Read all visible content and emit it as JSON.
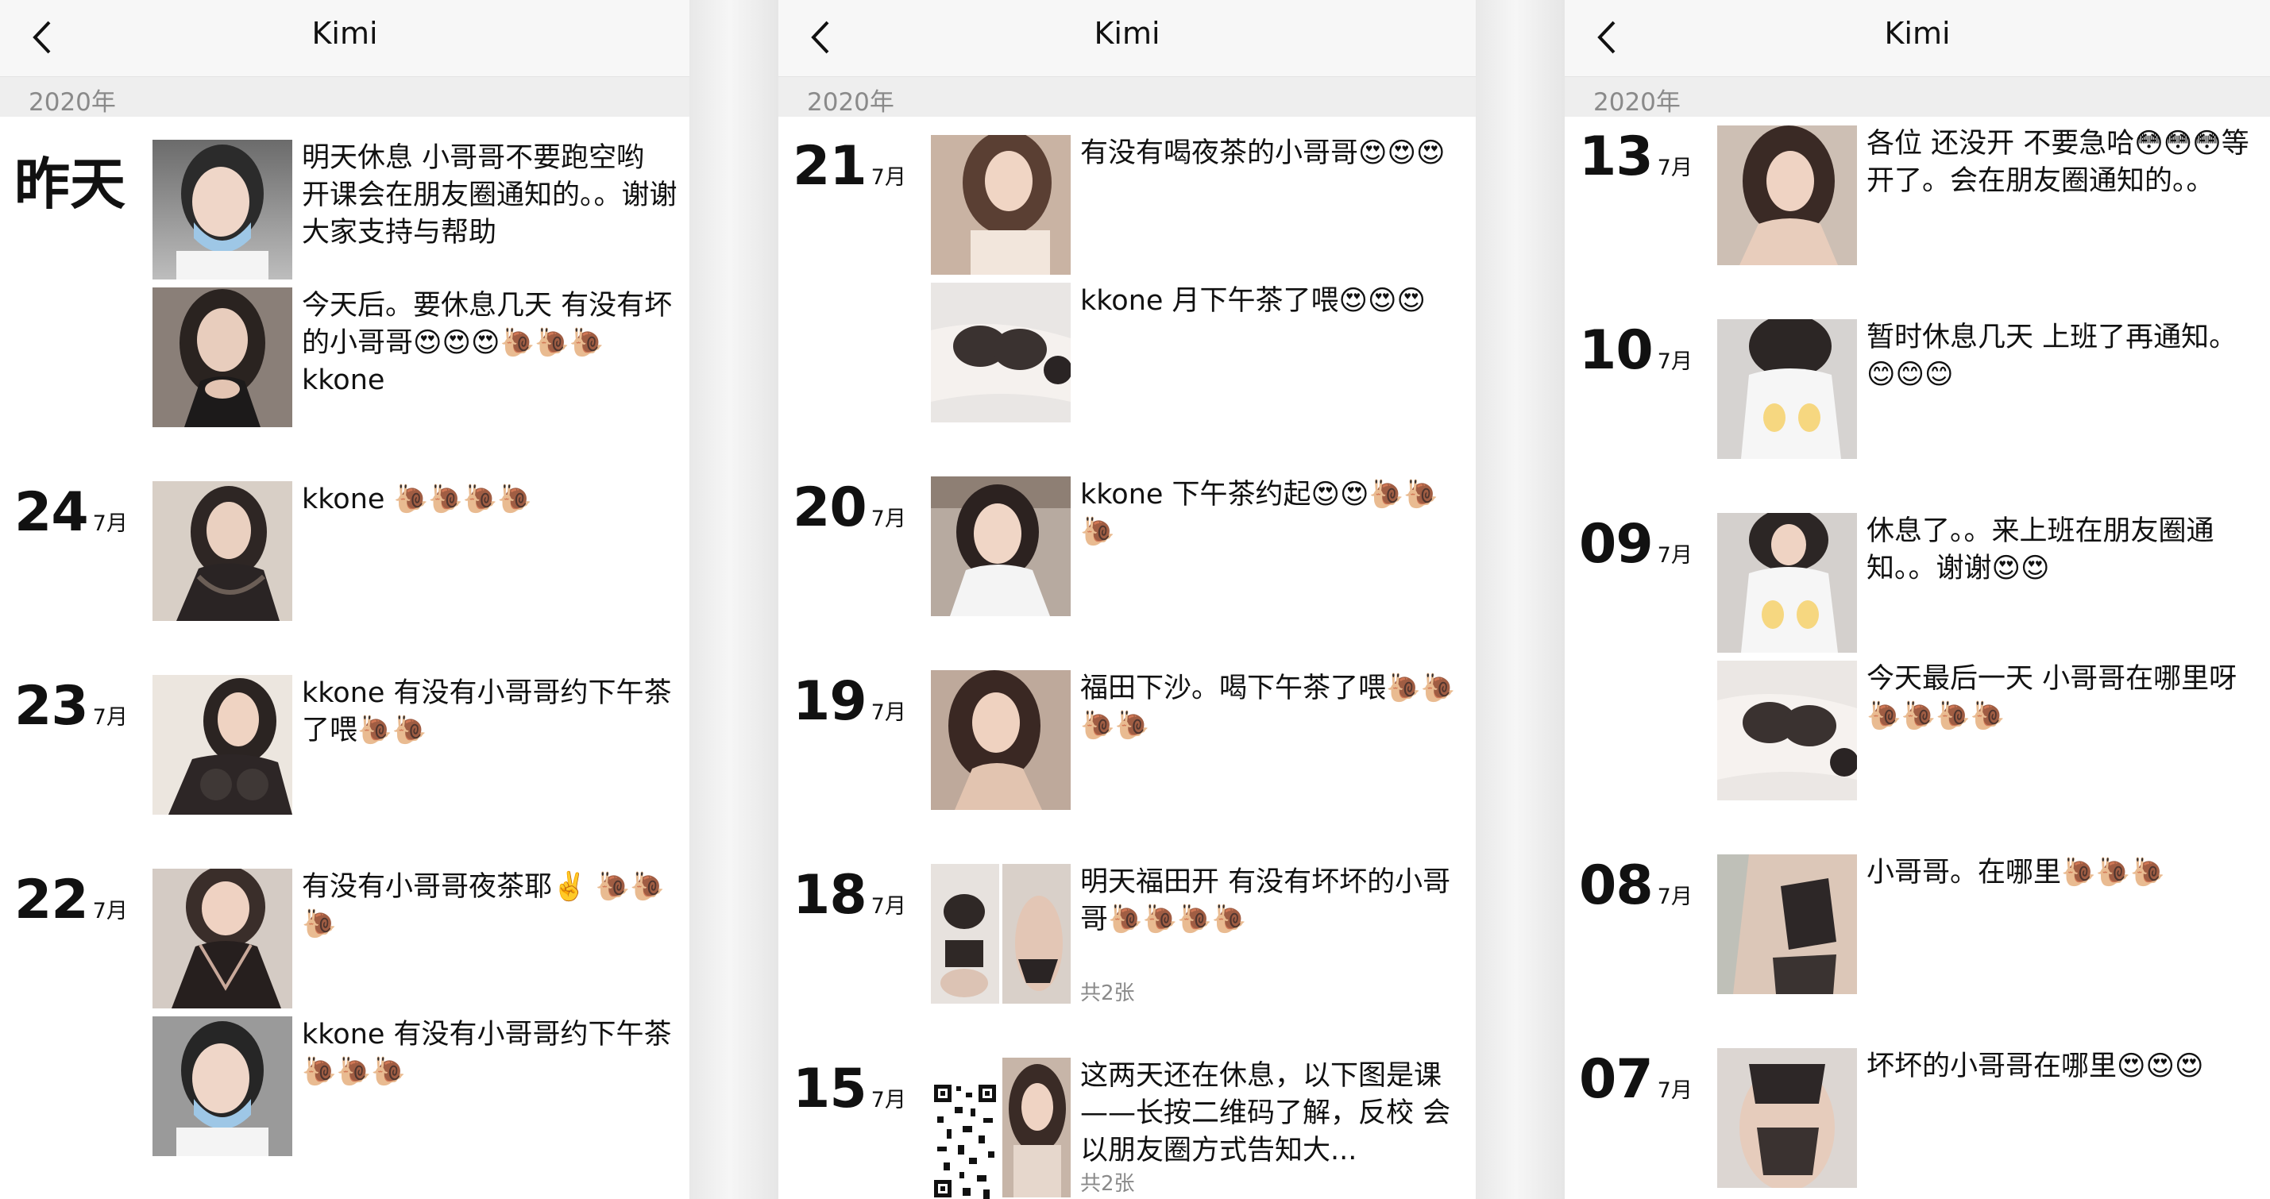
{
  "panels": [
    {
      "title": "Kimi",
      "year": "2020年",
      "entries": [
        {
          "day": "昨天",
          "month": "",
          "posts": [
            {
              "text": "明天休息 小哥哥不要跑空哟 开课会在朋友圈通知的。。谢谢大家支持与帮助",
              "photos": 1
            },
            {
              "text": "今天后。要休息几天 有没有坏的小哥哥😍😍😍🐌🐌🐌kkone",
              "photos": 1
            }
          ]
        },
        {
          "day": "24",
          "month": "7月",
          "posts": [
            {
              "text": "kkone 🐌🐌🐌🐌",
              "photos": 1
            }
          ]
        },
        {
          "day": "23",
          "month": "7月",
          "posts": [
            {
              "text": "kkone 有没有小哥哥约下午茶了喂🐌🐌",
              "photos": 1
            }
          ]
        },
        {
          "day": "22",
          "month": "7月",
          "posts": [
            {
              "text": "有没有小哥哥夜茶耶✌️ 🐌🐌🐌",
              "photos": 1
            },
            {
              "text": "kkone 有没有小哥哥约下午茶🐌🐌🐌",
              "photos": 1
            }
          ]
        }
      ]
    },
    {
      "title": "Kimi",
      "year": "2020年",
      "entries": [
        {
          "day": "21",
          "month": "7月",
          "posts": [
            {
              "text": "有没有喝夜茶的小哥哥😍😍😍",
              "photos": 1
            },
            {
              "text": "kkone 月下午茶了喂😍😍😍",
              "photos": 1
            }
          ]
        },
        {
          "day": "20",
          "month": "7月",
          "posts": [
            {
              "text": "kkone 下午茶约起😍😍🐌🐌🐌",
              "photos": 1
            }
          ]
        },
        {
          "day": "19",
          "month": "7月",
          "posts": [
            {
              "text": "福田下沙。喝下午茶了喂🐌🐌🐌🐌",
              "photos": 1
            }
          ]
        },
        {
          "day": "18",
          "month": "7月",
          "posts": [
            {
              "text": "明天福田开 有没有坏坏的小哥哥🐌🐌🐌🐌",
              "photos": 2,
              "count": "共2张"
            }
          ]
        },
        {
          "day": "15",
          "month": "7月",
          "posts": [
            {
              "text": "这两天还在休息，以下图是课——长按二维码了解，反校 会以朋友圈方式告知大...",
              "photos": 2,
              "qr": true,
              "count": "共2张"
            }
          ]
        }
      ]
    },
    {
      "title": "Kimi",
      "year": "2020年",
      "entries": [
        {
          "day": "13",
          "month": "7月",
          "posts": [
            {
              "text": "各位 还没开 不要急哈😳😳😳等开了。会在朋友圈通知的。。",
              "photos": 1
            }
          ]
        },
        {
          "day": "10",
          "month": "7月",
          "posts": [
            {
              "text": "暂时休息几天 上班了再通知。 😊😊😊",
              "photos": 1
            }
          ]
        },
        {
          "day": "09",
          "month": "7月",
          "posts": [
            {
              "text": "休息了。。来上班在朋友圈通知。。谢谢😍😍",
              "photos": 1
            },
            {
              "text": "今天最后一天 小哥哥在哪里呀🐌🐌🐌🐌",
              "photos": 1
            }
          ]
        },
        {
          "day": "08",
          "month": "7月",
          "posts": [
            {
              "text": "小哥哥。在哪里🐌🐌🐌",
              "photos": 1
            }
          ]
        },
        {
          "day": "07",
          "month": "7月",
          "posts": [
            {
              "text": "坏坏的小哥哥在哪里😍😍😍",
              "photos": 1
            }
          ]
        }
      ]
    }
  ]
}
